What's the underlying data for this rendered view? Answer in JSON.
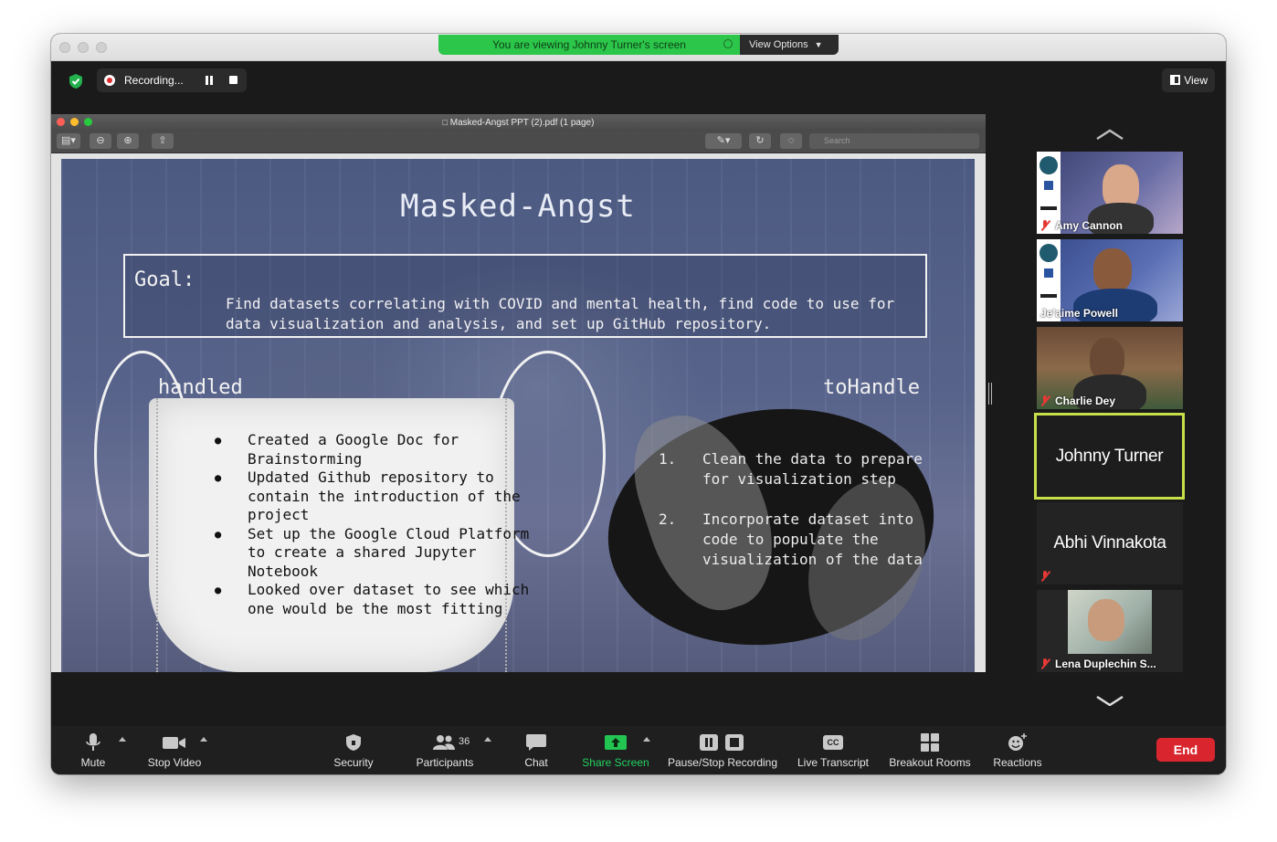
{
  "share_banner": {
    "text": "You are viewing Johnny Turner's screen",
    "options_label": "View Options"
  },
  "topbar": {
    "recording_label": "Recording...",
    "view_label": "View"
  },
  "preview": {
    "file_title": "Masked-Angst PPT (2).pdf (1 page)",
    "search_placeholder": "Search"
  },
  "slide": {
    "title": "Masked-Angst",
    "goal_label": "Goal:",
    "goal_text": "Find datasets correlating with COVID and mental health, find code to use for data visualization and analysis, and set up GitHub repository.",
    "handled_heading": "handled",
    "handled_items": [
      "Created a Google Doc for Brainstorming",
      "Updated Github repository to contain the introduction of the project",
      "Set up the Google Cloud Platform to create a shared Jupyter Notebook",
      "Looked over dataset to see which one would be the most fitting"
    ],
    "tohandle_heading": "toHandle",
    "tohandle_items": [
      {
        "num": "1.",
        "text": "Clean the data to prepare for visualization step"
      },
      {
        "num": "2.",
        "text": "Incorporate dataset into code to populate the visualization of the data"
      }
    ]
  },
  "participants": [
    {
      "name": "Amy Cannon",
      "video": true,
      "muted": true
    },
    {
      "name": "Je'aime Powell",
      "video": true,
      "muted": false
    },
    {
      "name": "Charlie Dey",
      "video": true,
      "muted": true
    },
    {
      "name": "Johnny Turner",
      "video": false,
      "muted": false,
      "active_speaker": true
    },
    {
      "name": "Abhi Vinnakota",
      "video": false,
      "muted": true
    },
    {
      "name": "Lena Duplechin S...",
      "video": true,
      "muted": true
    }
  ],
  "toolbar": {
    "mute": "Mute",
    "stop_video": "Stop Video",
    "security": "Security",
    "participants": "Participants",
    "participants_count": "36",
    "chat": "Chat",
    "share_screen": "Share Screen",
    "pause_stop_recording": "Pause/Stop Recording",
    "live_transcript": "Live Transcript",
    "breakout_rooms": "Breakout Rooms",
    "reactions": "Reactions",
    "end": "End",
    "cc_icon_text": "CC"
  },
  "colors": {
    "share_green": "#2cc74a",
    "end_red": "#d9262e",
    "active_speaker": "#c7e04a",
    "muted_red": "#e53935"
  }
}
